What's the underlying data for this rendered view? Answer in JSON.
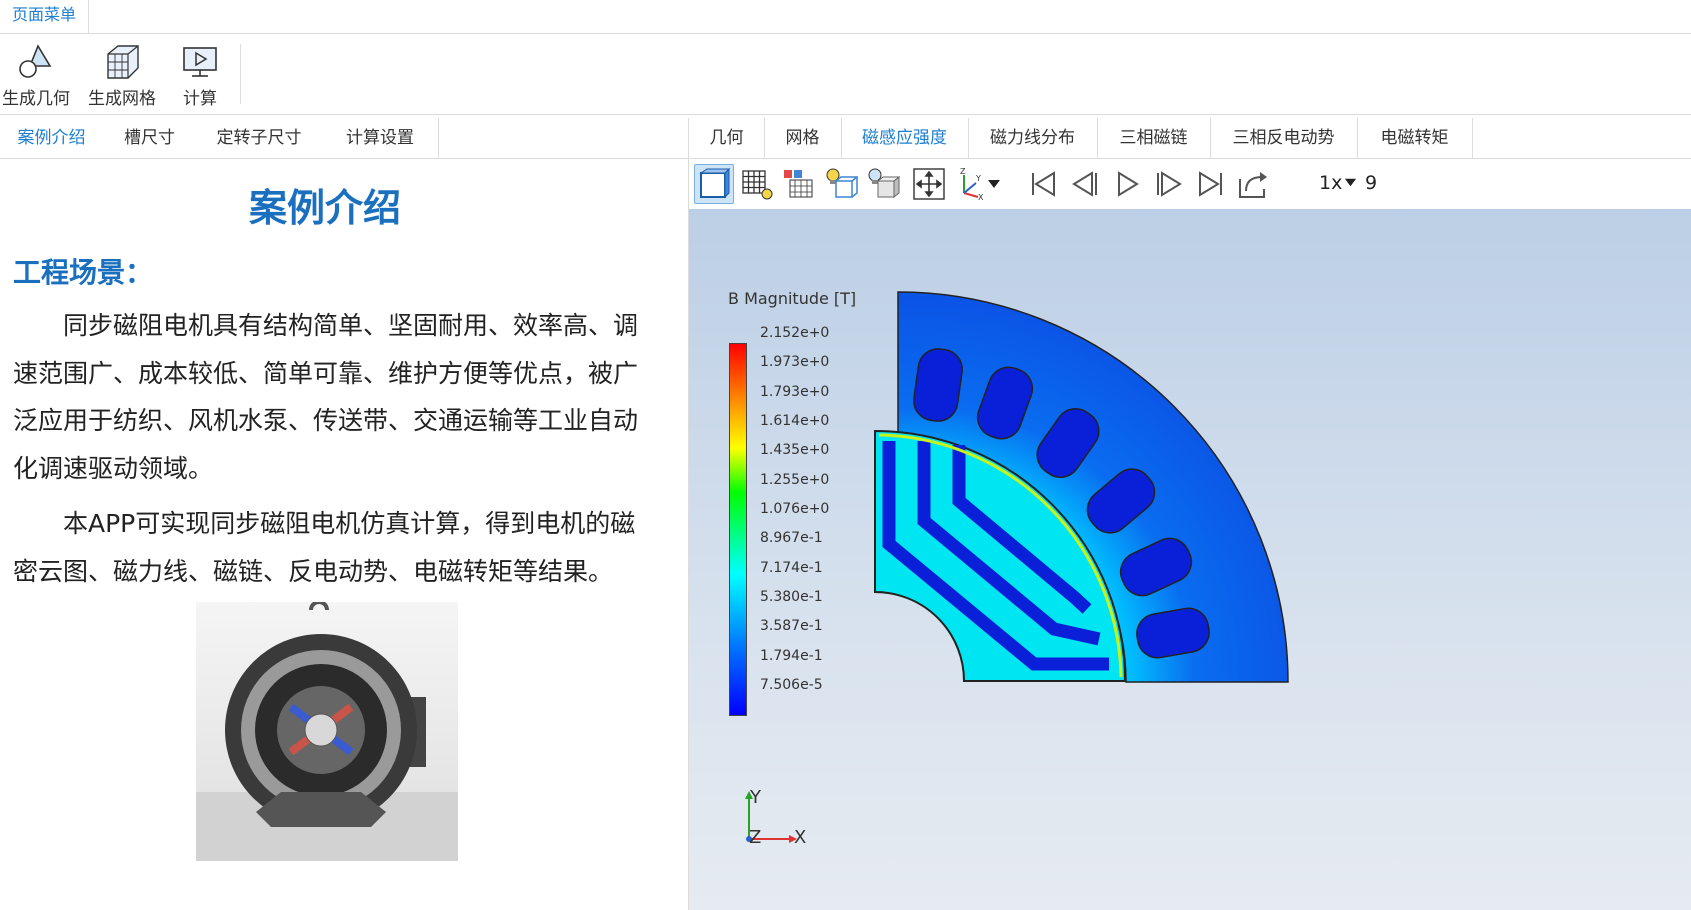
{
  "menu": {
    "tab_label": "页面菜单"
  },
  "ribbon": {
    "buttons": [
      {
        "label": "生成几何",
        "icon": "geometry-icon"
      },
      {
        "label": "生成网格",
        "icon": "mesh-icon"
      },
      {
        "label": "计算",
        "icon": "compute-icon"
      }
    ]
  },
  "left": {
    "tabs": [
      "案例介绍",
      "槽尺寸",
      "定转子尺寸",
      "计算设置"
    ],
    "active_tab": "案例介绍",
    "title": "案例介绍",
    "section": "工程场景：",
    "para1": "同步磁阻电机具有结构简单、坚固耐用、效率高、调速范围广、成本较低、简单可靠、维护方便等优点，被广泛应用于纺织、风机水泵、传送带、交通运输等工业自动化调速驱动领域。",
    "para2": "本APP可实现同步磁阻电机仿真计算，得到电机的磁密云图、磁力线、磁链、反电动势、电磁转矩等结果。"
  },
  "right": {
    "tabs": [
      "几何",
      "网格",
      "磁感应强度",
      "磁力线分布",
      "三相磁链",
      "三相反电动势",
      "电磁转矩"
    ],
    "active_tab": "磁感应强度",
    "toolbar": {
      "speed": "1x",
      "frame": "9"
    },
    "legend": {
      "title": "B Magnitude [T]",
      "ticks": [
        "2.152e+0",
        "1.973e+0",
        "1.793e+0",
        "1.614e+0",
        "1.435e+0",
        "1.255e+0",
        "1.076e+0",
        "8.967e-1",
        "7.174e-1",
        "5.380e-1",
        "3.587e-1",
        "1.794e-1",
        "7.506e-5"
      ]
    },
    "axes": {
      "y": "Y",
      "z": "Z",
      "x": "X"
    }
  },
  "colors": {
    "accent": "#1e7fd0",
    "title": "#1a6fbf"
  }
}
